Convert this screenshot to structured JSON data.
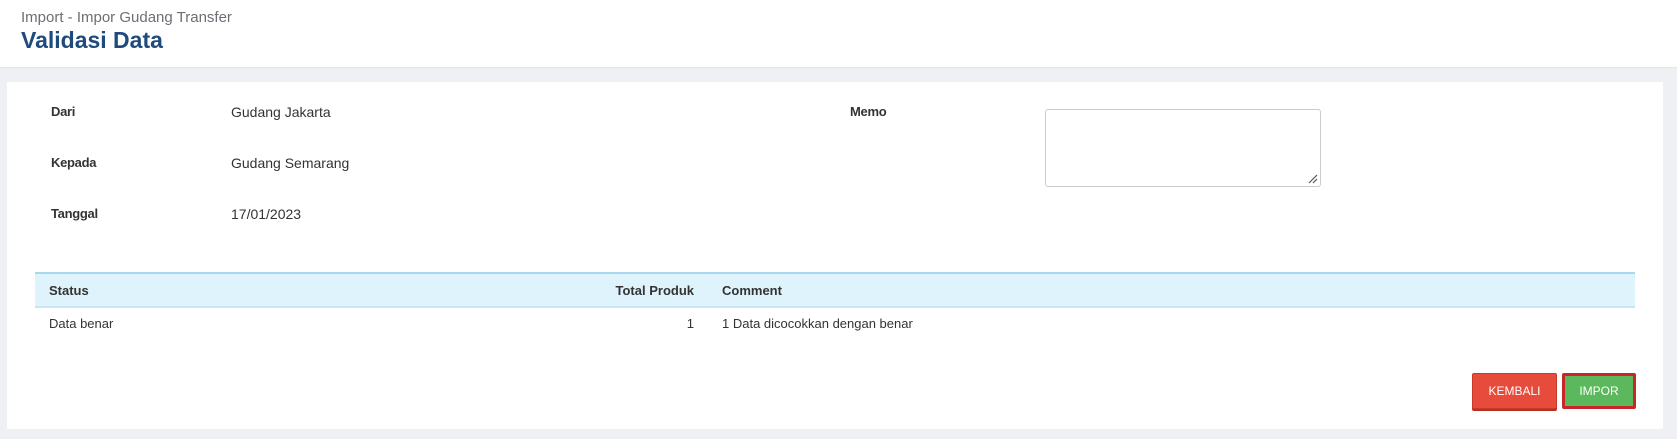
{
  "header": {
    "breadcrumb": "Import - Impor Gudang Transfer",
    "title": "Validasi Data"
  },
  "form": {
    "from_label": "Dari",
    "from_value": "Gudang Jakarta",
    "to_label": "Kepada",
    "to_value": "Gudang Semarang",
    "date_label": "Tanggal",
    "date_value": "17/01/2023",
    "memo_label": "Memo",
    "memo_value": ""
  },
  "table": {
    "headers": {
      "status": "Status",
      "total": "Total Produk",
      "comment": "Comment"
    },
    "rows": [
      {
        "status": "Data benar",
        "total": "1",
        "comment": "1 Data dicocokkan dengan benar"
      }
    ]
  },
  "actions": {
    "back_label": "KEMBALI",
    "import_label": "IMPOR"
  },
  "colors": {
    "title": "#1e4a7c",
    "back_button": "#e64b3c",
    "import_button": "#5cb85c",
    "table_header": "#dff3fc"
  }
}
